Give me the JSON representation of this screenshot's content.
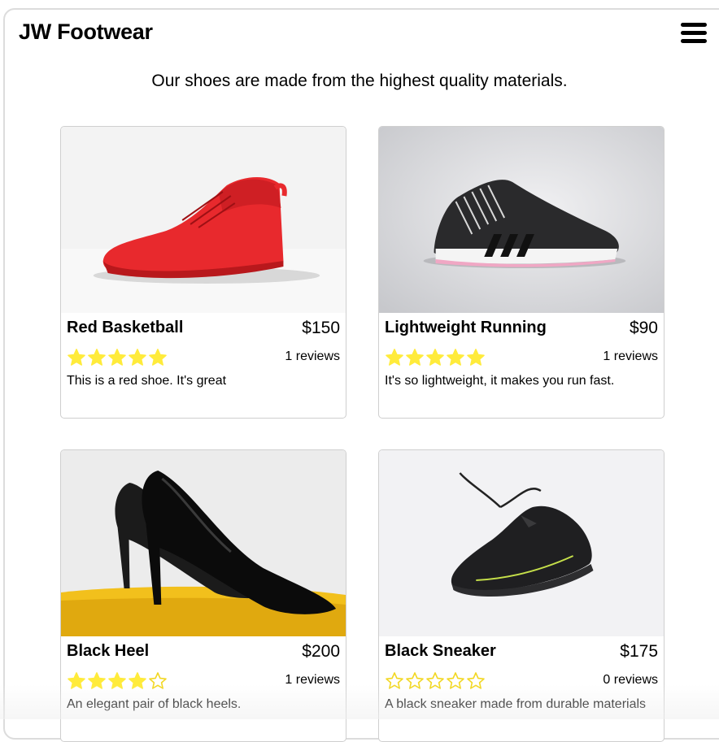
{
  "header": {
    "brand": "JW Footwear",
    "menu_icon": "hamburger-menu-icon"
  },
  "tagline": "Our shoes are made from the highest quality materials.",
  "colors": {
    "star_fill": "#FFEB3B",
    "star_outline": "#F2D722",
    "card_border": "#cfcfcf"
  },
  "products": [
    {
      "name": "Red Basketball",
      "price": "$150",
      "rating": 5,
      "reviews": "1 reviews",
      "description": "This is a red shoe. It's great"
    },
    {
      "name": "Lightweight Running",
      "price": "$90",
      "rating": 5,
      "reviews": "1 reviews",
      "description": "It's so lightweight, it makes you run fast."
    },
    {
      "name": "Black Heel",
      "price": "$200",
      "rating": 4,
      "reviews": "1 reviews",
      "description": "An elegant pair of black heels."
    },
    {
      "name": "Black Sneaker",
      "price": "$175",
      "rating": 0,
      "reviews": "0 reviews",
      "description": "A black sneaker made from durable materials"
    }
  ]
}
